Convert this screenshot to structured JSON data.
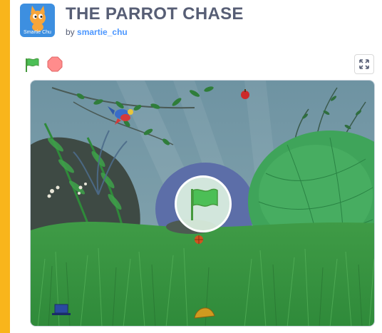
{
  "project": {
    "title": "THE PARROT CHASE",
    "by_label": "by",
    "author": "smartie_chu",
    "thumbnail_label": "Smartie Chu"
  },
  "controls": {
    "green_flag_icon": "green-flag-icon",
    "stop_icon": "stop-sign-icon",
    "fullscreen_icon": "fullscreen-icon"
  },
  "colors": {
    "page_background": "#f9b51b",
    "title_text": "#575e75",
    "author_link": "#4c97ff",
    "flag_green": "#4cbf56",
    "stop_red": "#ff8c8c"
  }
}
